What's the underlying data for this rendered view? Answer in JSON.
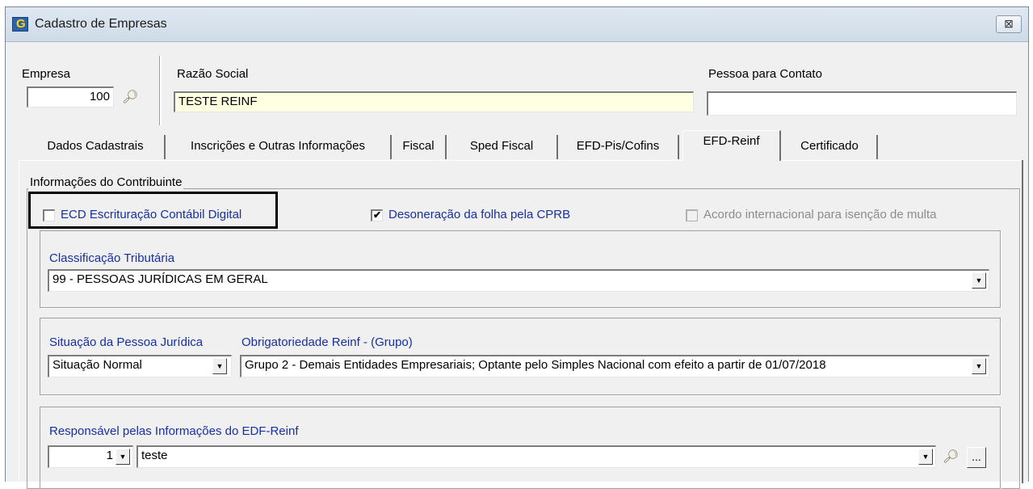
{
  "window": {
    "title": "Cadastro de Empresas",
    "app_icon": "app-logo-icon",
    "close_icon": "close-icon",
    "close_label": "⊠"
  },
  "header": {
    "empresa_label": "Empresa",
    "empresa_value": "100",
    "razao_label": "Razão Social",
    "razao_value": "TESTE REINF",
    "contato_label": "Pessoa para Contato",
    "contato_value": ""
  },
  "tabs": [
    {
      "label": "Dados Cadastrais"
    },
    {
      "label": "Inscrições e Outras Informações"
    },
    {
      "label": "Fiscal"
    },
    {
      "label": "Sped Fiscal"
    },
    {
      "label": "EFD-Pis/Cofins"
    },
    {
      "label": "EFD-Reinf",
      "active": true
    },
    {
      "label": "Certificado"
    }
  ],
  "contribuinte": {
    "group_title": "Informações do Contribuinte",
    "ecd_label": "ECD Escrituração Contábil Digital",
    "ecd_checked": false,
    "desoneracao_label": "Desoneração da folha pela CPRB",
    "desoneracao_checked": true,
    "acordo_label": "Acordo internacional para isenção de multa",
    "acordo_checked": false,
    "acordo_enabled": false
  },
  "classificacao": {
    "label": "Classificação Tributária",
    "value": "99 - PESSOAS JURÍDICAS EM GERAL"
  },
  "situacao": {
    "label": "Situação da Pessoa Jurídica",
    "value": "Situação Normal"
  },
  "obrigatoriedade": {
    "label": "Obrigatoriedade Reinf - (Grupo)",
    "value": "Grupo 2 - Demais Entidades Empresariais; Optante pelo Simples Nacional com efeito a partir de 01/07/2018"
  },
  "responsavel": {
    "label": "Responsável pelas Informações do EDF-Reinf",
    "code": "1",
    "name": "teste",
    "more_label": "..."
  },
  "colors": {
    "label_blue": "#1630a0",
    "window_bg": "#f0f0f0",
    "yellow_field": "#ffffe1"
  }
}
